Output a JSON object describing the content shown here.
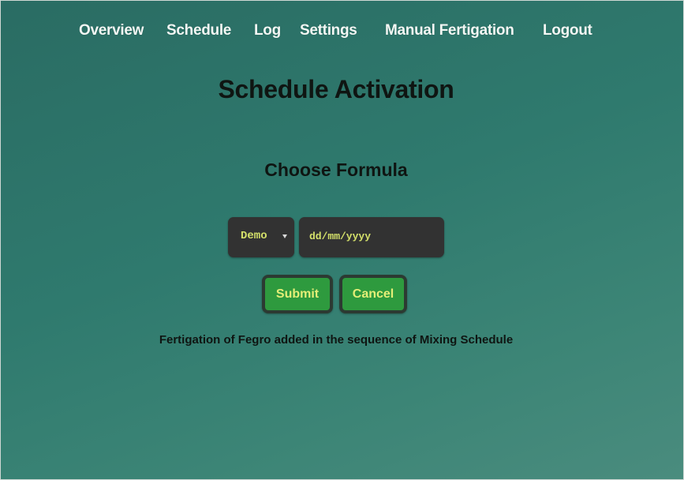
{
  "nav": {
    "items": [
      {
        "label": "Overview"
      },
      {
        "label": "Schedule"
      },
      {
        "label": "Log"
      },
      {
        "label": "Settings"
      },
      {
        "label": "Manual Fertigation"
      },
      {
        "label": "Logout"
      }
    ]
  },
  "page": {
    "title": "Schedule Activation",
    "subtitle": "Choose Formula"
  },
  "form": {
    "formula_select": {
      "selected": "Demo"
    },
    "date_input": {
      "placeholder": "dd/mm/yyyy",
      "value": ""
    },
    "submit_label": "Submit",
    "cancel_label": "Cancel"
  },
  "status_message": "Fertigation of Fegro added in the sequence of Mixing Schedule",
  "colors": {
    "background": "#2f7468",
    "input_background": "#323232",
    "input_text": "#d4e06a",
    "button_background": "#2e9a3e",
    "button_text": "#e4ee77",
    "nav_text": "#f3f7f4",
    "heading_text": "#0f1512"
  }
}
